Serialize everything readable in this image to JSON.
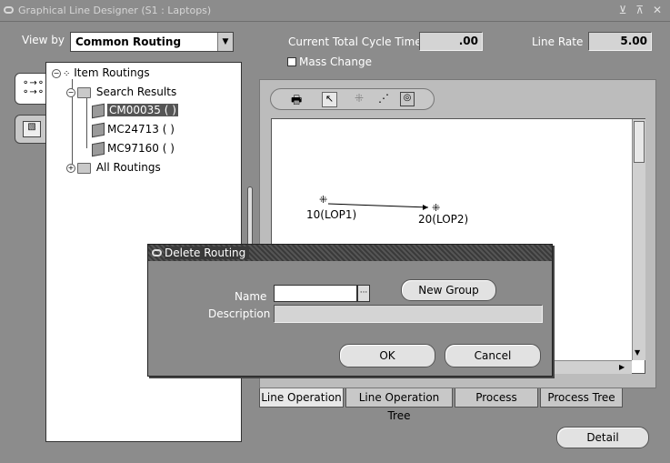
{
  "window": {
    "title": "Graphical Line Designer (S1 : Laptops)"
  },
  "header": {
    "view_by_label": "View by",
    "view_by_value": "Common Routing",
    "cycle_time_label": "Current Total Cycle Time",
    "cycle_time_value": ".00",
    "line_rate_label": "Line Rate",
    "line_rate_value": "5.00",
    "mass_change_label": "Mass Change"
  },
  "tree": {
    "root": "Item Routings",
    "search_results": "Search Results",
    "items": [
      "CM00035 ( )",
      "MC24713 ( )",
      "MC97160 ( )"
    ],
    "all_routings": "All Routings"
  },
  "diagram": {
    "nodes": [
      {
        "label": "10(LOP1)"
      },
      {
        "label": "20(LOP2)"
      }
    ]
  },
  "tabs": [
    "Line Operation",
    "Line Operation Tree",
    "Process",
    "Process Tree"
  ],
  "detail_button": "Detail",
  "dialog": {
    "title": "Delete Routing",
    "name_label": "Name",
    "description_label": "Description",
    "name_value": "",
    "new_group_button": "New Group",
    "ok_button": "OK",
    "cancel_button": "Cancel"
  },
  "colors": {
    "background": "#8c8c8c",
    "dialog_bg": "#8a8a8a",
    "selected_bg": "#555555"
  }
}
